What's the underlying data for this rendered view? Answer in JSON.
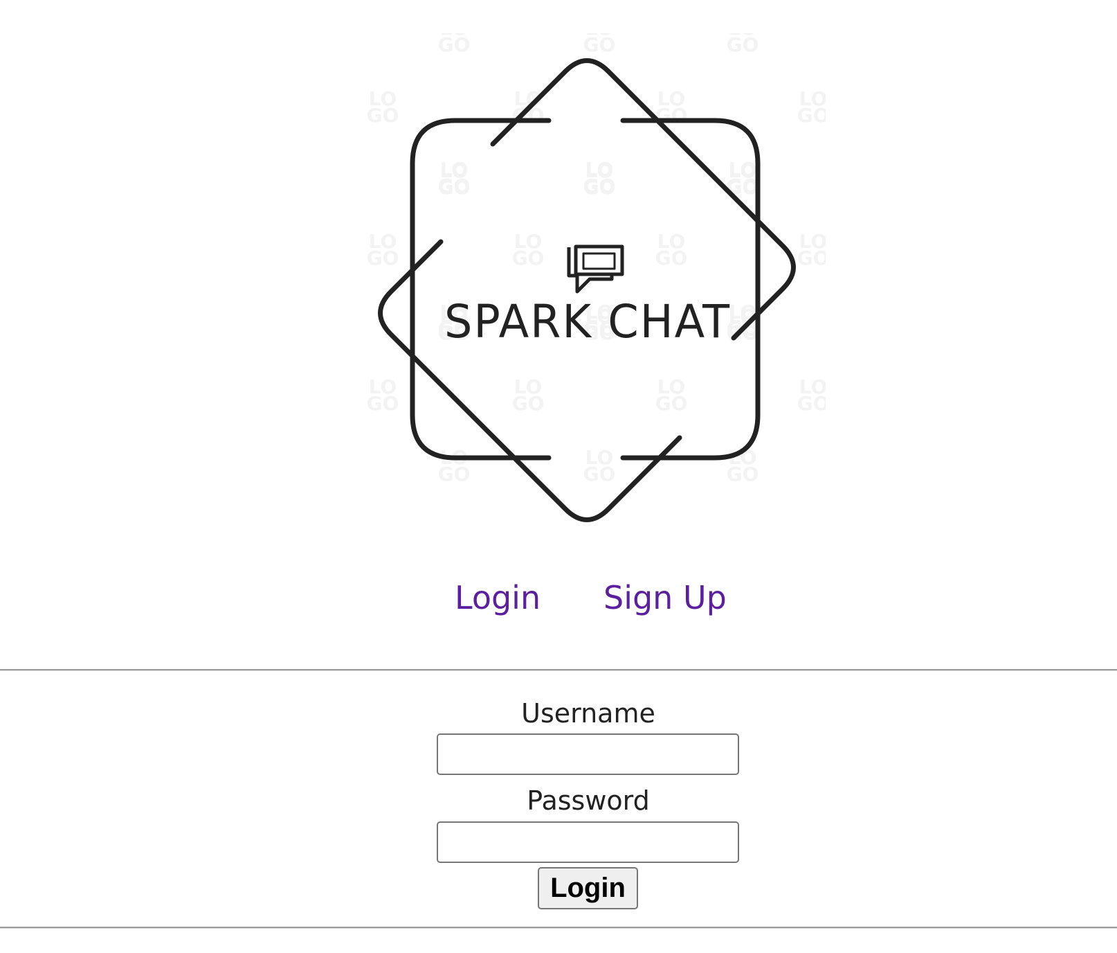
{
  "logo": {
    "title": "SPARK CHAT",
    "watermark_text": "LOGO",
    "icon": "chat-bubbles-icon"
  },
  "nav": {
    "login_label": "Login",
    "signup_label": "Sign Up"
  },
  "form": {
    "username_label": "Username",
    "username_value": "",
    "password_label": "Password",
    "password_value": "",
    "submit_label": "Login"
  },
  "colors": {
    "link": "#5b1f9f",
    "logo_stroke": "#222222",
    "divider": "#9a9a9a",
    "button_bg": "#efefef"
  }
}
